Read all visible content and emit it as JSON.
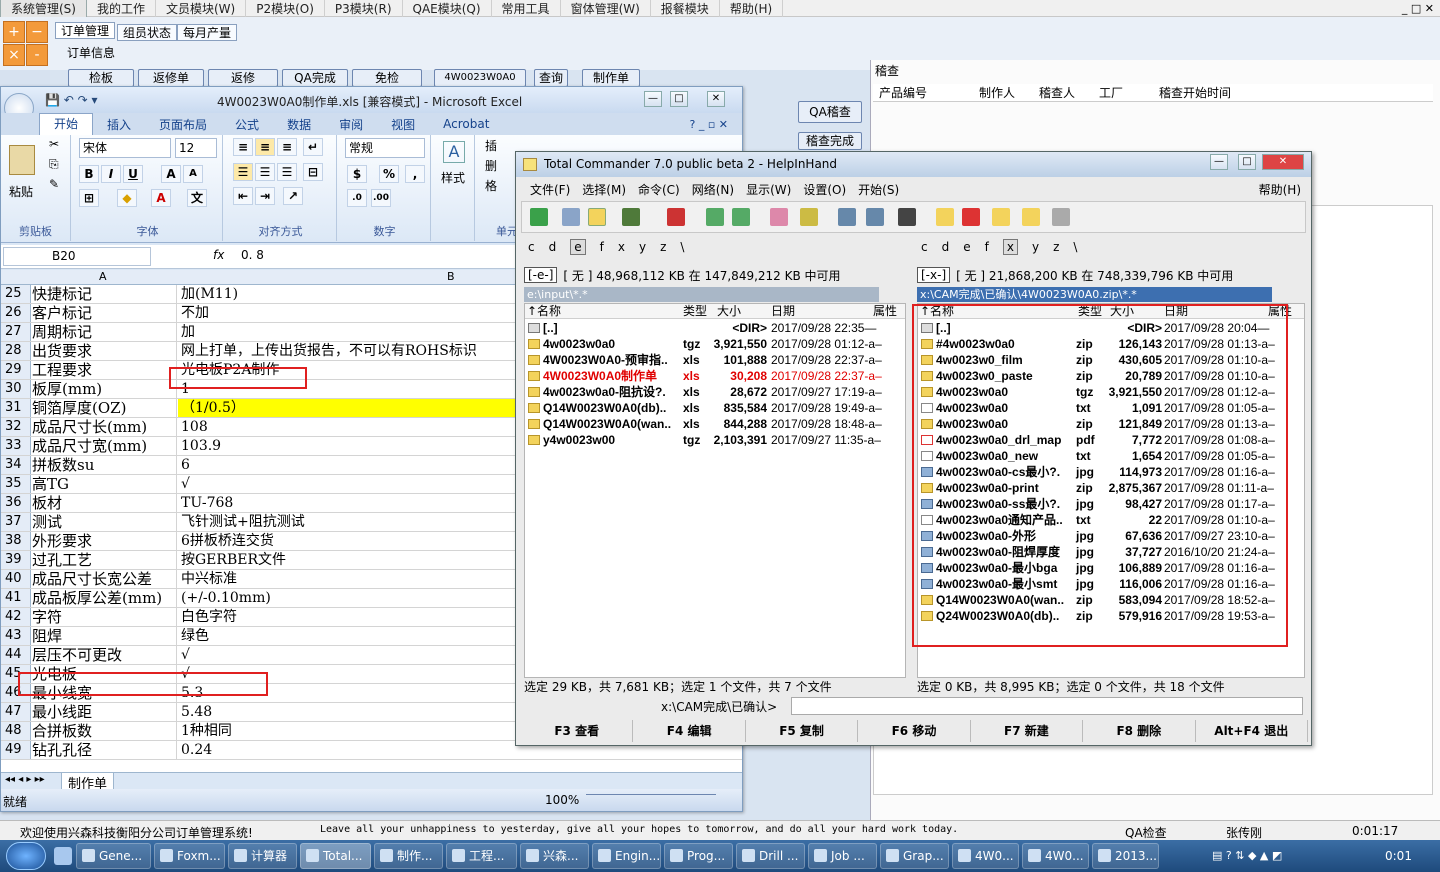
{
  "topmenu": {
    "items": [
      "系统管理(S)",
      "我的工作",
      "文员模块(W)",
      "P2模块(O)",
      "P3模块(R)",
      "QAE模块(Q)",
      "常用工具",
      "窗体管理(W)",
      "报餐模块",
      "帮助(H)"
    ]
  },
  "topapp": {
    "subtabs": [
      "订单管理",
      "组员状态",
      "每月产量"
    ],
    "order_info_label": "订单信息",
    "order_buttons": [
      "检板",
      "返修单",
      "返修",
      "QA完成",
      "免检",
      "4W0023W0A0",
      "查询",
      "制作单"
    ],
    "audit_label": "稽查",
    "audit_columns": [
      "产品编号",
      "制作人",
      "稽查人",
      "工厂",
      "稽查开始时间"
    ],
    "qa_buttons": [
      "QA稽查",
      "稽查完成"
    ]
  },
  "excel": {
    "title": "4W0023W0A0制作单.xls  [兼容模式]  -  Microsoft Excel",
    "tabs": [
      "开始",
      "插入",
      "页面布局",
      "公式",
      "数据",
      "审阅",
      "视图",
      "Acrobat"
    ],
    "ribbon": {
      "paste": "粘贴",
      "clipboard": "剪贴板",
      "font_name": "宋体",
      "font_size": "12",
      "font_group": "字体",
      "align_group": "对齐方式",
      "number_format": "常规",
      "number_group": "数字",
      "style_label": "样式",
      "cells_label1": "插",
      "cells_label2": "删",
      "cells_label3": "格",
      "cells_group": "单元"
    },
    "name_box": "B20",
    "fx": "fx",
    "formula": "0. 8",
    "col_a": "A",
    "col_b": "B",
    "rows": [
      {
        "n": "25",
        "a": "快捷标记",
        "b": "加(M11)"
      },
      {
        "n": "26",
        "a": "客户标记",
        "b": "不加"
      },
      {
        "n": "27",
        "a": "周期标记",
        "b": "加"
      },
      {
        "n": "28",
        "a": "出货要求",
        "b": "网上打单，上传出货报告，不可以有ROHS标识"
      },
      {
        "n": "29",
        "a": "工程要求",
        "b": "光电板P2A制作"
      },
      {
        "n": "30",
        "a": "板厚(mm)",
        "b": "1"
      },
      {
        "n": "31",
        "a": "铜箔厚度(OZ)",
        "b": "（1/0.5）"
      },
      {
        "n": "32",
        "a": "成品尺寸长(mm)",
        "b": "108"
      },
      {
        "n": "33",
        "a": "成品尺寸宽(mm)",
        "b": "103.9"
      },
      {
        "n": "34",
        "a": "拼板数su",
        "b": "6"
      },
      {
        "n": "35",
        "a": "高TG",
        "b": "√"
      },
      {
        "n": "36",
        "a": "板材",
        "b": "TU-768"
      },
      {
        "n": "37",
        "a": "测试",
        "b": "飞针测试+阻抗测试"
      },
      {
        "n": "38",
        "a": "外形要求",
        "b": "6拼板桥连交货"
      },
      {
        "n": "39",
        "a": "过孔工艺",
        "b": "按GERBER文件"
      },
      {
        "n": "40",
        "a": "成品尺寸长宽公差",
        "b": "中兴标准"
      },
      {
        "n": "41",
        "a": "成品板厚公差(mm)",
        "b": "(+/-0.10mm)"
      },
      {
        "n": "42",
        "a": "字符",
        "b": "白色字符"
      },
      {
        "n": "43",
        "a": "阻焊",
        "b": "绿色"
      },
      {
        "n": "44",
        "a": "层压不可更改",
        "b": "√"
      },
      {
        "n": "45",
        "a": "光电板",
        "b": "√"
      },
      {
        "n": "46",
        "a": "最小线宽",
        "b": "5.3"
      },
      {
        "n": "47",
        "a": "最小线距",
        "b": "5.48"
      },
      {
        "n": "48",
        "a": "合拼板数",
        "b": "1种相同"
      },
      {
        "n": "49",
        "a": "钻孔孔径",
        "b": "0.24"
      }
    ],
    "sheet_tab": "制作单",
    "status": "就绪",
    "zoom": "100%",
    "highlight_color": "#ffff00"
  },
  "tc": {
    "title": "Total Commander 7.0 public beta 2 - HelpInHand",
    "menu": [
      "文件(F)",
      "选择(M)",
      "命令(C)",
      "网络(N)",
      "显示(W)",
      "设置(O)",
      "开始(S)"
    ],
    "help": "帮助(H)",
    "drives": [
      "c",
      "d",
      "e",
      "f",
      "x",
      "y",
      "z",
      "\\"
    ],
    "left": {
      "drive": "[-e-]",
      "info": "[ 无 ]  48,968,112 KB 在 147,849,212 KB 中可用",
      "path": "e:\\input\\*.*",
      "cols": [
        "↑名称",
        "类型",
        "大小",
        "日期",
        "属性"
      ],
      "files": [
        {
          "name": "[..]",
          "ext": "",
          "size": "<DIR>",
          "date": "2017/09/28 22:35—",
          "kind": "up",
          "red": false
        },
        {
          "name": "4w0023w0a0",
          "ext": "tgz",
          "size": "3,921,550",
          "date": "2017/09/28 01:12-a–",
          "kind": "folder",
          "red": false
        },
        {
          "name": "4W0023W0A0-预审指..",
          "ext": "xls",
          "size": "101,888",
          "date": "2017/09/28 22:37-a–",
          "kind": "folder",
          "red": false
        },
        {
          "name": "4W0023W0A0制作单",
          "ext": "xls",
          "size": "30,208",
          "date": "2017/09/28 22:37-a–",
          "kind": "folder",
          "red": true
        },
        {
          "name": "4w0023w0a0-阻抗设?.",
          "ext": "xls",
          "size": "28,672",
          "date": "2017/09/27 17:19-a–",
          "kind": "folder",
          "red": false
        },
        {
          "name": "Q14W0023W0A0(db)..",
          "ext": "xls",
          "size": "835,584",
          "date": "2017/09/28 19:49-a–",
          "kind": "folder",
          "red": false
        },
        {
          "name": "Q14W0023W0A0(wan..",
          "ext": "xls",
          "size": "844,288",
          "date": "2017/09/28 18:48-a–",
          "kind": "folder",
          "red": false
        },
        {
          "name": "y4w0023w00",
          "ext": "tgz",
          "size": "2,103,391",
          "date": "2017/09/27 11:35-a–",
          "kind": "folder",
          "red": false
        }
      ],
      "status": "选定 29 KB，共 7,681 KB；选定 1 个文件，共 7 个文件"
    },
    "right": {
      "drive": "[-x-]",
      "info": "[ 无 ]  21,868,200 KB 在 748,339,796 KB 中可用",
      "path": "x:\\CAM完成\\已确认\\4W0023W0A0.zip\\*.*",
      "cols": [
        "↑名称",
        "类型",
        "大小",
        "日期",
        "属性"
      ],
      "files": [
        {
          "name": "[..]",
          "ext": "",
          "size": "<DIR>",
          "date": "2017/09/28 20:04—",
          "kind": "up"
        },
        {
          "name": "#4w0023w0a0",
          "ext": "zip",
          "size": "126,143",
          "date": "2017/09/28 01:13-a–",
          "kind": "folder"
        },
        {
          "name": "4w0023w0_film",
          "ext": "zip",
          "size": "430,605",
          "date": "2017/09/28 01:10-a–",
          "kind": "folder"
        },
        {
          "name": "4w0023w0_paste",
          "ext": "zip",
          "size": "20,789",
          "date": "2017/09/28 01:10-a–",
          "kind": "folder"
        },
        {
          "name": "4w0023w0a0",
          "ext": "tgz",
          "size": "3,921,550",
          "date": "2017/09/28 01:12-a–",
          "kind": "folder"
        },
        {
          "name": "4w0023w0a0",
          "ext": "txt",
          "size": "1,091",
          "date": "2017/09/28 01:05-a–",
          "kind": "doc"
        },
        {
          "name": "4w0023w0a0",
          "ext": "zip",
          "size": "121,849",
          "date": "2017/09/28 01:13-a–",
          "kind": "folder"
        },
        {
          "name": "4w0023w0a0_drl_map",
          "ext": "pdf",
          "size": "7,772",
          "date": "2017/09/28 01:08-a–",
          "kind": "pdf"
        },
        {
          "name": "4w0023w0a0_new",
          "ext": "txt",
          "size": "1,654",
          "date": "2017/09/28 01:05-a–",
          "kind": "doc"
        },
        {
          "name": "4w0023w0a0-cs最小?.",
          "ext": "jpg",
          "size": "114,973",
          "date": "2017/09/28 01:16-a–",
          "kind": "img"
        },
        {
          "name": "4w0023w0a0-print",
          "ext": "zip",
          "size": "2,875,367",
          "date": "2017/09/28 01:11-a–",
          "kind": "folder"
        },
        {
          "name": "4w0023w0a0-ss最小?.",
          "ext": "jpg",
          "size": "98,427",
          "date": "2017/09/28 01:17-a–",
          "kind": "img"
        },
        {
          "name": "4w0023w0a0通知产品..",
          "ext": "txt",
          "size": "22",
          "date": "2017/09/28 01:10-a–",
          "kind": "doc"
        },
        {
          "name": "4w0023w0a0-外形",
          "ext": "jpg",
          "size": "67,636",
          "date": "2017/09/27 23:10-a–",
          "kind": "img"
        },
        {
          "name": "4w0023w0a0-阻焊厚度",
          "ext": "jpg",
          "size": "37,727",
          "date": "2016/10/20 21:24-a–",
          "kind": "img"
        },
        {
          "name": "4w0023w0a0-最小bga",
          "ext": "jpg",
          "size": "106,889",
          "date": "2017/09/28 01:16-a–",
          "kind": "img"
        },
        {
          "name": "4w0023w0a0-最小smt",
          "ext": "jpg",
          "size": "116,006",
          "date": "2017/09/28 01:16-a–",
          "kind": "img"
        },
        {
          "name": "Q14W0023W0A0(wan..",
          "ext": "zip",
          "size": "583,094",
          "date": "2017/09/28 18:52-a–",
          "kind": "folder"
        },
        {
          "name": "Q24W0023W0A0(db)..",
          "ext": "zip",
          "size": "579,916",
          "date": "2017/09/28 19:53-a–",
          "kind": "folder"
        }
      ],
      "status": "选定 0 KB，共 8,995 KB；选定 0 个文件，共 18 个文件"
    },
    "cmd_path": "x:\\CAM完成\\已确认>",
    "fkeys": [
      "F3 查看",
      "F4 编辑",
      "F5 复制",
      "F6 移动",
      "F7 新建",
      "F8 删除",
      "Alt+F4 退出"
    ]
  },
  "bottom": {
    "welcome": "欢迎使用兴森科技衡阳分公司订单管理系统!",
    "motto": "Leave all your unhappiness to yesterday, give all your hopes to tomorrow, and do all your hard work today.",
    "role": "QA检查",
    "user": "张传刚",
    "timer": "0:01:17"
  },
  "taskbar": {
    "items": [
      "Gene...",
      "Foxm...",
      "计算器",
      "Total...",
      "制作...",
      "工程...",
      "兴森...",
      "Engin...",
      "Prog...",
      "Drill ...",
      "Job ...",
      "Grap...",
      "4W0...",
      "4W0...",
      "2013..."
    ],
    "clock": "0:01"
  }
}
